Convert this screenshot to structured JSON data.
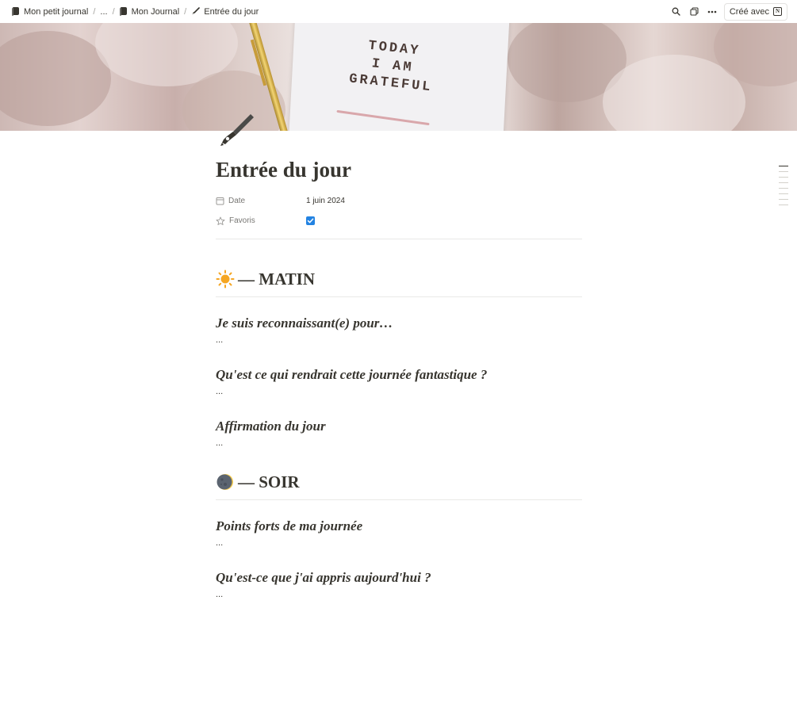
{
  "topbar": {
    "breadcrumbs": [
      {
        "label": "Mon petit journal",
        "icon": "book-icon"
      },
      {
        "label": "..."
      },
      {
        "label": "Mon Journal",
        "icon": "book-icon"
      },
      {
        "label": "Entrée du jour",
        "icon": "pen-icon"
      }
    ],
    "separator": "/",
    "made_with_label": "Créé avec"
  },
  "cover": {
    "notebook_text": [
      "TODAY",
      "I AM",
      "GRATEFUL"
    ]
  },
  "page": {
    "icon": "fountain-pen-icon",
    "title": "Entrée du jour",
    "properties": [
      {
        "name": "Date",
        "icon": "calendar-icon",
        "value": "1 juin 2024"
      },
      {
        "name": "Favoris",
        "icon": "star-icon",
        "checked": true
      }
    ]
  },
  "sections": [
    {
      "icon": "sun-icon",
      "title": "— MATIN",
      "questions": [
        {
          "q": "Je suis reconnaissant(e) pour…",
          "a": "..."
        },
        {
          "q": "Qu'est ce qui rendrait cette journée fantastique ?",
          "a": "..."
        },
        {
          "q": "Affirmation du jour",
          "a": "..."
        }
      ]
    },
    {
      "icon": "moon-icon",
      "title": "— SOIR",
      "questions": [
        {
          "q": "Points forts de ma journée",
          "a": "..."
        },
        {
          "q": "Qu'est-ce que j'ai appris aujourd'hui ?",
          "a": "..."
        }
      ]
    }
  ],
  "colors": {
    "text": "#37352f",
    "muted": "#787774",
    "accent": "#2383e2",
    "sun": "#f5a623"
  }
}
